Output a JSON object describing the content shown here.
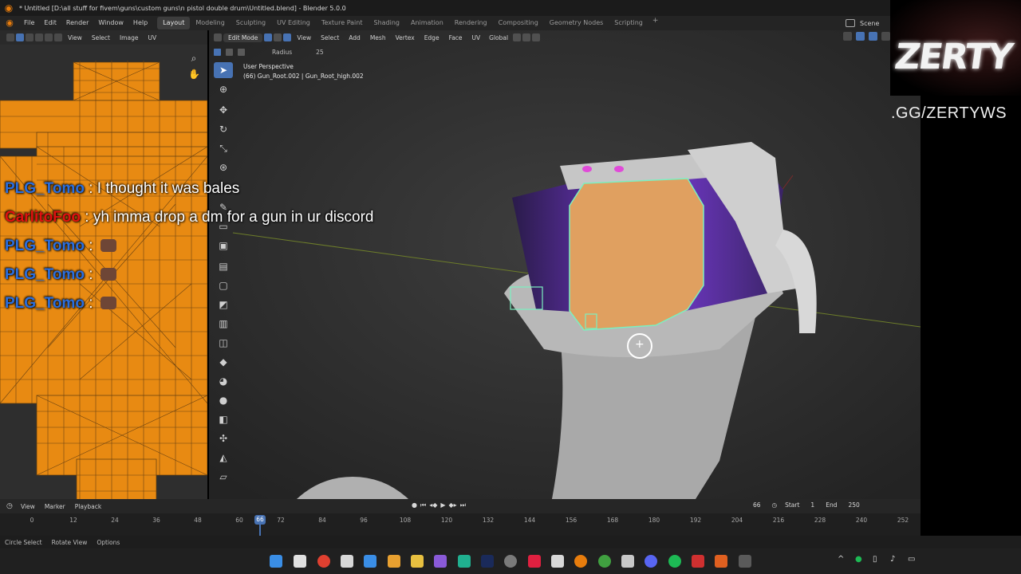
{
  "window": {
    "title": "* Untitled [D:\\all stuff for fivem\\guns\\custom guns\\n pistol double drum\\Untitled.blend] - Blender 5.0.0"
  },
  "menubar": {
    "menus": [
      "File",
      "Edit",
      "Render",
      "Window",
      "Help"
    ],
    "workspaces": [
      "Layout",
      "Modeling",
      "Sculpting",
      "UV Editing",
      "Texture Paint",
      "Shading",
      "Animation",
      "Rendering",
      "Compositing",
      "Geometry Nodes",
      "Scripting"
    ],
    "active_workspace": "Layout",
    "scene": "Scene"
  },
  "uv_editor": {
    "menus": [
      "View",
      "Select",
      "Image",
      "UV"
    ],
    "colors": {
      "island_fill": "#e88a12",
      "wire": "#5a3a10"
    }
  },
  "viewport": {
    "mode": "Edit Mode",
    "menus": [
      "View",
      "Select",
      "Add",
      "Mesh",
      "Vertex",
      "Edge",
      "Face",
      "UV"
    ],
    "orientation": "Global",
    "tool_setting_label": "Radius",
    "tool_setting_value": "25",
    "info_line_1": "User Perspective",
    "info_line_2": "(66) Gun_Root.002 | Gun_Root_high.002",
    "tools": [
      "select-tool",
      "cursor-tool",
      "move-tool",
      "rotate-tool",
      "scale-tool",
      "transform-tool",
      "annotate-tool",
      "measure-tool",
      "add-cube-tool",
      "extrude-tool",
      "inset-tool",
      "bevel-tool",
      "loop-cut-tool",
      "knife-tool",
      "poly-build-tool",
      "spin-tool",
      "smooth-tool",
      "edge-slide-tool",
      "shrink-tool",
      "shear-tool",
      "rip-tool"
    ],
    "colors": {
      "selection": "#e8a04a",
      "highlight": "#7bf0c0",
      "purple": "#7a3cd8"
    }
  },
  "overlay": {
    "logo_text": "ZERTY",
    "discord": ".GG/ZERTYWS",
    "chat": [
      {
        "user": "PLG_Tomo",
        "color": "#2a6fe0",
        "message": " : I thought it was bales"
      },
      {
        "user": "CarlitoFoo",
        "color": "#e01010",
        "message": " : yh imma drop a dm for a gun in ur discord"
      },
      {
        "user": "PLG_Tomo",
        "color": "#2a6fe0",
        "message": " : "
      },
      {
        "user": "PLG_Tomo",
        "color": "#2a6fe0",
        "message": " : "
      },
      {
        "user": "PLG_Tomo",
        "color": "#2a6fe0",
        "message": " : "
      }
    ]
  },
  "timeline": {
    "menus": [
      "View",
      "Marker",
      "Playback"
    ],
    "current_frame": "66",
    "start_label": "Start",
    "start": "1",
    "end_label": "End",
    "end": "250",
    "ticks": [
      "0",
      "12",
      "24",
      "36",
      "48",
      "60",
      "72",
      "84",
      "96",
      "108",
      "120",
      "132",
      "144",
      "156",
      "168",
      "180",
      "192",
      "204",
      "216",
      "228",
      "240",
      "252"
    ]
  },
  "statusbar": {
    "hints": [
      "Circle Select",
      "Rotate View",
      "Options"
    ]
  },
  "taskbar": {
    "icons": [
      "windows-start-icon",
      "app-m-icon",
      "chrome-icon",
      "store-icon",
      "vlc-icon",
      "file-explorer-icon",
      "app-purple-icon",
      "vscode-icon",
      "app-3-icon",
      "photoshop-icon",
      "settings-icon",
      "adobe-icon",
      "app-bug-icon",
      "blender-icon",
      "chrome-icon-2",
      "app-bug-icon-2",
      "discord-icon",
      "spotify-icon",
      "app-red-icon",
      "app-orange-icon",
      "app-tray-icon"
    ]
  }
}
